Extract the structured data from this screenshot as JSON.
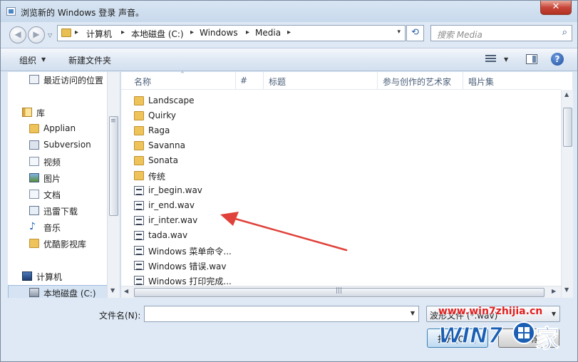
{
  "window": {
    "title": "浏览新的 Windows 登录 声音。",
    "close_glyph": "✕"
  },
  "nav": {
    "back_glyph": "◀",
    "forward_glyph": "▶",
    "history_arrow": "▽"
  },
  "address": {
    "sep": "▸",
    "crumbs": [
      "计算机",
      "本地磁盘 (C:)",
      "Windows",
      "Media"
    ],
    "dropdown_glyph": "▾",
    "refresh_glyph": "⟲"
  },
  "search": {
    "placeholder": "搜索 Media",
    "icon": "search-icon",
    "icon_glyph": "⌕"
  },
  "toolbar": {
    "organize_label": "组织",
    "arrow_glyph": "▼",
    "new_folder_label": "新建文件夹",
    "help_glyph": "?"
  },
  "sidebar": {
    "items": [
      {
        "label": "最近访问的位置",
        "icon": "recent-places-icon"
      },
      {
        "label": "库",
        "icon": "library-icon"
      },
      {
        "label": "Applian",
        "icon": "folder-icon"
      },
      {
        "label": "Subversion",
        "icon": "subversion-icon"
      },
      {
        "label": "视频",
        "icon": "video-icon"
      },
      {
        "label": "图片",
        "icon": "pictures-icon"
      },
      {
        "label": "文档",
        "icon": "documents-icon"
      },
      {
        "label": "迅雷下载",
        "icon": "download-icon"
      },
      {
        "label": "音乐",
        "icon": "music-icon"
      },
      {
        "label": "优酷影视库",
        "icon": "folder-icon"
      },
      {
        "label": "计算机",
        "icon": "computer-icon"
      },
      {
        "label": "本地磁盘 (C:)",
        "icon": "disk-icon"
      }
    ],
    "note_glyph": "♪",
    "scroll_grip": "≡",
    "scroll_down": "▼"
  },
  "columns": {
    "name": "名称",
    "number": "#",
    "title": "标题",
    "artist": "参与创作的艺术家",
    "album": "唱片集",
    "sort_glyph": "^"
  },
  "files": [
    {
      "name": "Landscape",
      "type": "folder"
    },
    {
      "name": "Quirky",
      "type": "folder"
    },
    {
      "name": "Raga",
      "type": "folder"
    },
    {
      "name": "Savanna",
      "type": "folder"
    },
    {
      "name": "Sonata",
      "type": "folder"
    },
    {
      "name": "传统",
      "type": "folder"
    },
    {
      "name": "ir_begin.wav",
      "type": "wav"
    },
    {
      "name": "ir_end.wav",
      "type": "wav"
    },
    {
      "name": "ir_inter.wav",
      "type": "wav"
    },
    {
      "name": "tada.wav",
      "type": "wav"
    },
    {
      "name": "Windows 菜单命令...",
      "type": "wav"
    },
    {
      "name": "Windows 错误.wav",
      "type": "wav"
    },
    {
      "name": "Windows 打印完成...",
      "type": "wav"
    }
  ],
  "scroll": {
    "up": "▲",
    "down": "▼",
    "left": "◀",
    "right": "▶",
    "grip": "|||"
  },
  "bottom": {
    "filename_label": "文件名(N):",
    "filename_value": "",
    "dropdown_glyph": "▼",
    "filetype_value": "波形文件 (*.wav)",
    "open_label": "打开(O)",
    "cancel_label": "取消"
  },
  "watermark": {
    "url": "www.win7zhijia.cn",
    "logo_text": "WIN7",
    "logo_suffix": "家"
  },
  "colors": {
    "annotation_arrow": "#e0413a",
    "watermark_red": "#e02020",
    "watermark_blue": "#1a5fb4"
  }
}
